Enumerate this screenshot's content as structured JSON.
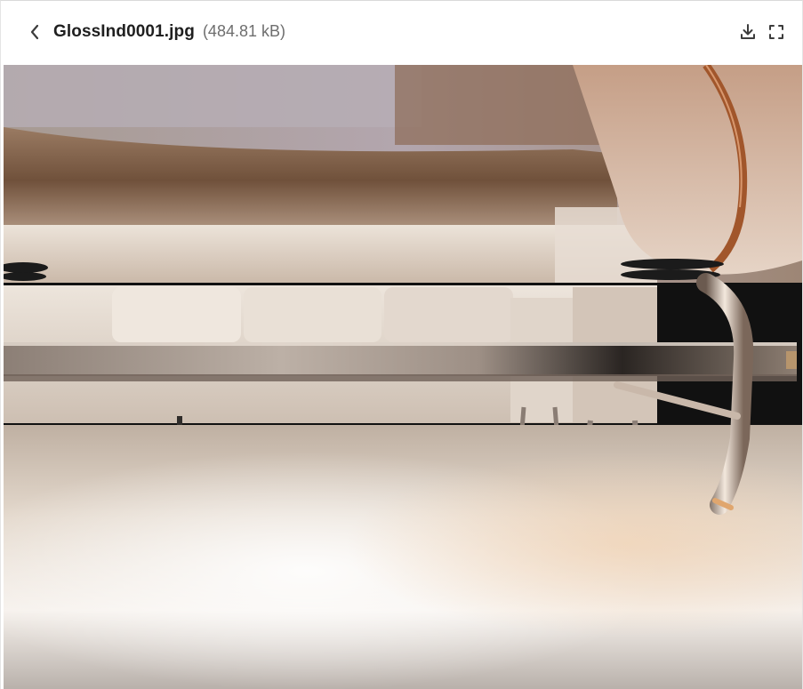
{
  "header": {
    "back_icon": "chevron-left-icon",
    "file_name": "GlossInd0001.jpg",
    "file_size": "(484.81 kB)",
    "download_icon": "download-icon",
    "fullscreen_icon": "fullscreen-icon"
  },
  "preview": {
    "image_subject": "3D render of a glossy metal coffee table with a white sofa and wooden ceiling reflection over a reflective floor"
  },
  "colors": {
    "title_text": "#1f1f1f",
    "size_text": "#6e6e6e",
    "icon_color": "#3c3c3c",
    "background": "#ffffff"
  }
}
